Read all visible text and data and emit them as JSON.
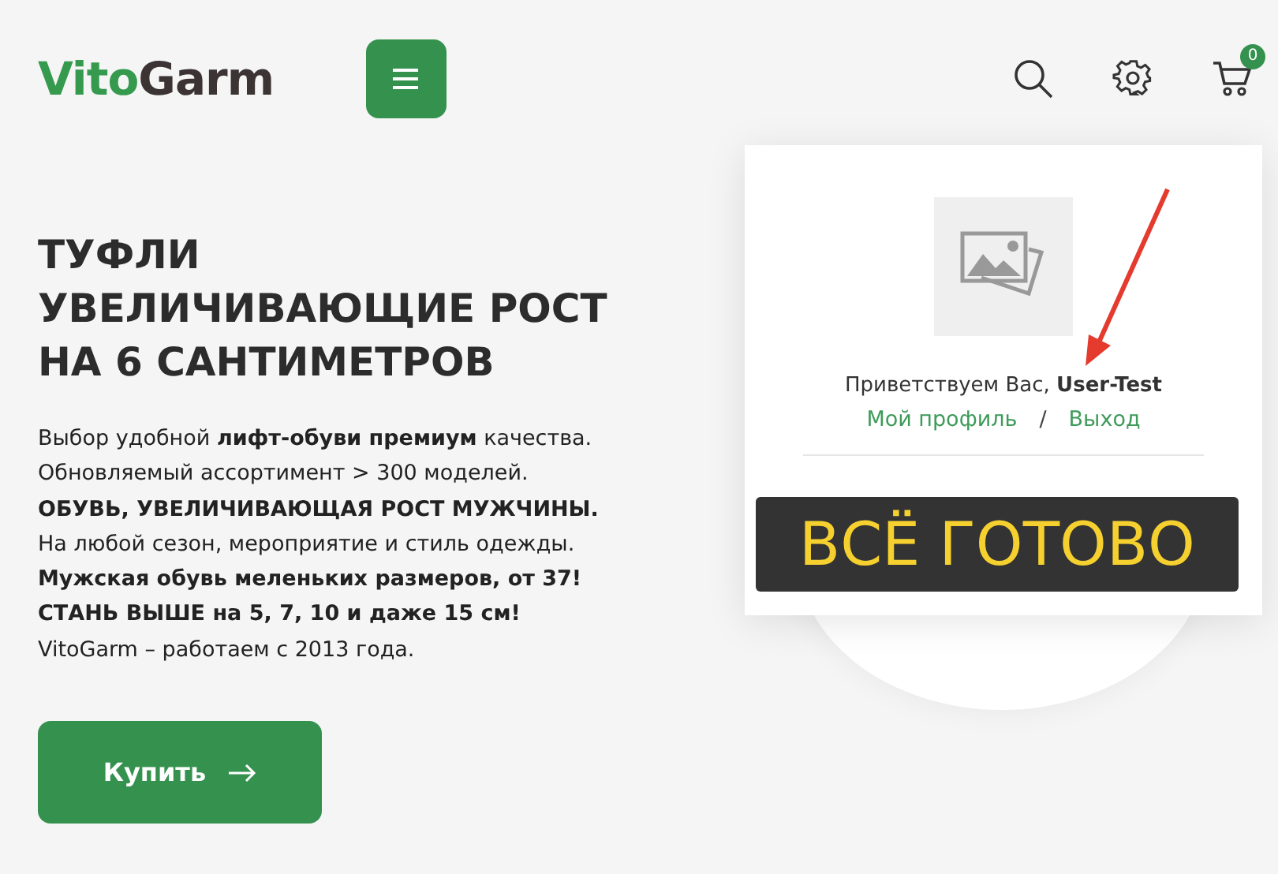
{
  "header": {
    "logo": {
      "first": "Vito",
      "second": "Garm"
    },
    "cart_count": "0"
  },
  "hero": {
    "title_lines": [
      "ТУФЛИ",
      "УВЕЛИЧИВАЮЩИЕ РОСТ",
      "НА 6 САНТИМЕТРОВ"
    ],
    "lines": [
      {
        "text": "Выбор удобной **лифт-обуви премиум** качества.",
        "bold": false
      },
      {
        "text": "Обновляемый ассортимент > 300 моделей.",
        "bold": false
      },
      {
        "text": "ОБУВЬ, УВЕЛИЧИВАЮЩАЯ РОСТ МУЖЧИНЫ.",
        "bold": true
      },
      {
        "text": "На любой сезон, мероприятие и стиль одежды.",
        "bold": false
      },
      {
        "text": "Мужская обувь меленьких размеров, от 37!",
        "bold": true
      },
      {
        "text": "СТАНЬ ВЫШЕ на 5, 7, 10 и даже 15 см!",
        "bold": true
      },
      {
        "text": "VitoGarm – работаем с 2013 года.",
        "bold": false
      }
    ],
    "buy_button": "Купить"
  },
  "account_menu": {
    "greeting": "Приветствуем Вас, **User-Test**",
    "links": [
      "Мой профиль",
      "Выход"
    ],
    "separator": "/"
  },
  "overlay_banner": "ВСЁ ГОТОВО"
}
